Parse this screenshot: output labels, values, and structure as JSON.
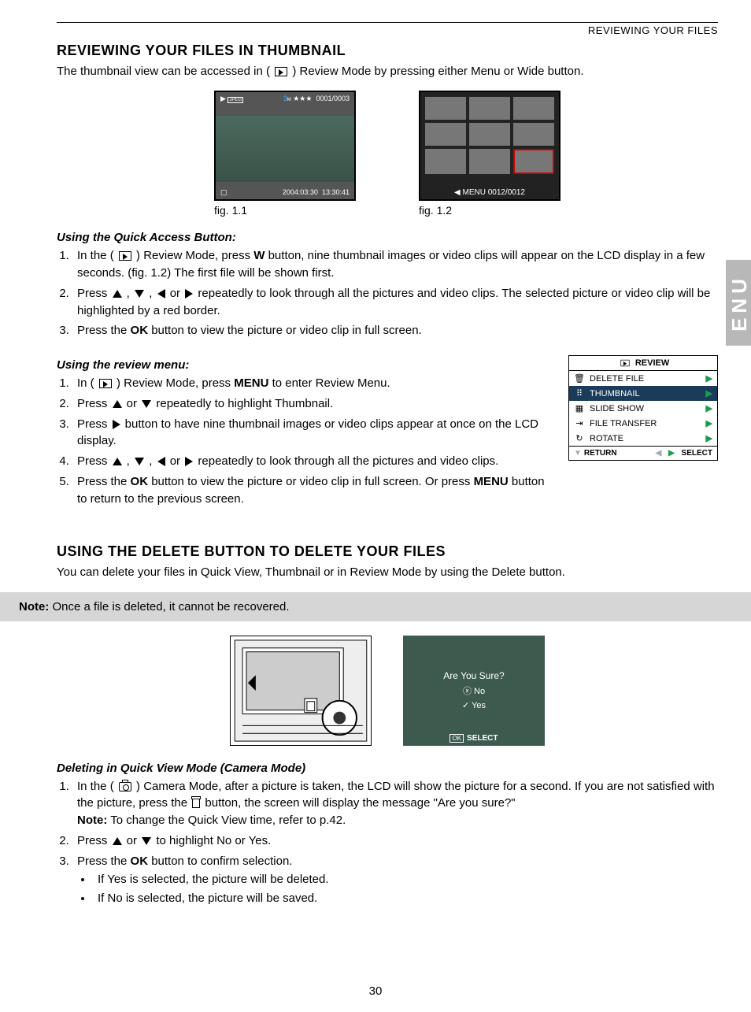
{
  "header": {
    "running_head": "REVIEWING YOUR FILES"
  },
  "sidetab": "ENU",
  "section1": {
    "title": "REVIEWING YOUR FILES IN THUMBNAIL",
    "intro_pre": "The thumbnail view can be accessed in ( ",
    "intro_post": " ) Review Mode by pressing either Menu or Wide button.",
    "fig1": {
      "caption": "fig. 1.1",
      "overlay_count": "0001/0003",
      "overlay_date": "2004:03:30",
      "overlay_time": "13:30:41",
      "overlay_stars": "★★★"
    },
    "fig2": {
      "caption": "fig. 1.2",
      "overlay_menu": "MENU  0012/0012"
    }
  },
  "quick_access": {
    "heading": "Using the Quick Access Button:",
    "s1_a": "In the ( ",
    "s1_b": " ) Review Mode, press ",
    "s1_c": " button, nine thumbnail images or video clips will appear on the LCD display in a few seconds. (fig. 1.2) The first file will be shown first.",
    "s1_bold": "W",
    "s2_a": "Press ",
    "s2_b": "  ,  ",
    "s2_c": "  ,  ",
    "s2_d": "  or ",
    "s2_e": "  repeatedly to look through all the pictures and video clips. The selected picture or video clip will be highlighted by a red border.",
    "s3_a": "Press the ",
    "s3_bold": "OK",
    "s3_b": " button to view the picture or video clip in full screen."
  },
  "review_menu_steps": {
    "heading": "Using the review menu:",
    "s1_a": "In ( ",
    "s1_b": " ) Review Mode, press ",
    "s1_bold": "MENU",
    "s1_c": " to enter Review Menu.",
    "s2_a": "Press ",
    "s2_b": " or ",
    "s2_c": " repeatedly to highlight Thumbnail.",
    "s3_a": "Press ",
    "s3_b": " button to have nine thumbnail images or video clips appear at once on the LCD display.",
    "s4_a": "Press  ",
    "s4_b": "  ,  ",
    "s4_c": " ,  ",
    "s4_d": " or ",
    "s4_e": "  repeatedly to look through all the pictures and video clips.",
    "s5_a": "Press the ",
    "s5_b1": "OK",
    "s5_b": " button to view the picture or video clip in full screen. Or press ",
    "s5_b2": "MENU",
    "s5_c": " button to return to the previous screen."
  },
  "review_menu_box": {
    "title": "REVIEW",
    "items": [
      {
        "icon": "🗑",
        "label": "DELETE FILE",
        "sel": false
      },
      {
        "icon": "⠿",
        "label": "THUMBNAIL",
        "sel": true
      },
      {
        "icon": "▦",
        "label": "SLIDE SHOW",
        "sel": false
      },
      {
        "icon": "⇥",
        "label": "FILE TRANSFER",
        "sel": false
      },
      {
        "icon": "↻",
        "label": "ROTATE",
        "sel": false
      }
    ],
    "footer_return": "RETURN",
    "footer_select": "SELECT"
  },
  "section2": {
    "title": "USING THE DELETE BUTTON TO DELETE YOUR FILES",
    "intro": "You can delete your files in Quick View, Thumbnail or in Review Mode by using the Delete button.",
    "note_label": "Note:",
    "note_text": " Once a file is deleted, it cannot be recovered."
  },
  "delete_fig": {
    "question": "Are You Sure?",
    "no": "No",
    "yes": "Yes",
    "ok": "OK",
    "select": "SELECT",
    "no_icon": "ⓧ",
    "yes_icon": "✓"
  },
  "deleting": {
    "heading": "Deleting in Quick View Mode (Camera Mode)",
    "s1_a": "In the ( ",
    "s1_b": " ) Camera Mode, after a picture is taken, the LCD will show the picture for a second. If you are not satisfied with the picture, press the ",
    "s1_c": "  button, the screen will display the message \"Are you sure?\"",
    "s1_note_label": "Note:",
    "s1_note": " To change the Quick View time, refer to p.42.",
    "s2_a": "Press ",
    "s2_b": " or ",
    "s2_c": " to highlight No or Yes.",
    "s3_a": "Press the ",
    "s3_bold": "OK",
    "s3_b": " button to confirm selection.",
    "b1": "If Yes is selected, the picture will be deleted.",
    "b2": "If No is selected, the picture will be saved."
  },
  "pagenum": "30"
}
